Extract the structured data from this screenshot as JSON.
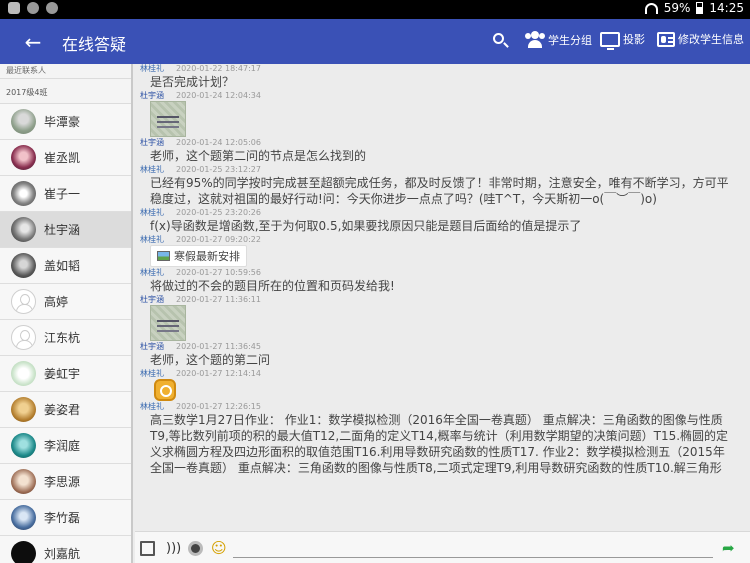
{
  "status_bar": {
    "battery": "59%",
    "time": "14:25"
  },
  "app_bar": {
    "title": "在线答疑",
    "actions": {
      "groups": "学生分组",
      "projection": "投影",
      "edit_info": "修改学生信息"
    }
  },
  "sidebar": {
    "header": "最近联系人",
    "section": "2017级4班",
    "contacts": [
      {
        "name": "毕潭豪"
      },
      {
        "name": "崔丞凯"
      },
      {
        "name": "崔子一"
      },
      {
        "name": "杜宇涵"
      },
      {
        "name": "盖如韬"
      },
      {
        "name": "高婷"
      },
      {
        "name": "江东杭"
      },
      {
        "name": "姜虹宇"
      },
      {
        "name": "姜姿君"
      },
      {
        "name": "李润庭"
      },
      {
        "name": "李思源"
      },
      {
        "name": "李竹磊"
      },
      {
        "name": "刘嘉航"
      }
    ]
  },
  "chat": {
    "messages": [
      {
        "sender": "林桂礼",
        "time": "2020-01-22 18:47:17",
        "text": "是否完成计划？"
      },
      {
        "sender": "杜宇涵",
        "time": "2020-01-24 12:04:34"
      },
      {
        "sender": "杜宇涵",
        "time": "2020-01-24 12:05:06",
        "text": "老师，这个题第二问的节点是怎么找到的"
      },
      {
        "sender": "林桂礼",
        "time": "2020-01-25 23:12:27",
        "text": "已经有95%的同学按时完成甚至超额完成任务，都及时反馈了！非常时期，注意安全，唯有不断学习，方可平稳度过，这就对祖国的最好行动!问：今天你进步一点点了吗？(哇T^T，今天斯初一o(￣︶￣)o)"
      },
      {
        "sender": "林桂礼",
        "time": "2020-01-25 23:20:26",
        "text": "f(x)导函数是增函数,至于为何取0.5,如果要找原因只能是题目后面给的值是提示了"
      },
      {
        "sender": "林桂礼",
        "time": "2020-01-27 09:20:22",
        "attachment": "寒假最新安排"
      },
      {
        "sender": "林桂礼",
        "time": "2020-01-27 10:59:56",
        "text": "将做过的不会的题目所在的位置和页码发给我!"
      },
      {
        "sender": "杜宇涵",
        "time": "2020-01-27 11:36:11"
      },
      {
        "sender": "杜宇涵",
        "time": "2020-01-27 11:36:45",
        "text": "老师，这个题的第二问"
      },
      {
        "sender": "林桂礼",
        "time": "2020-01-27 12:14:14"
      },
      {
        "sender": "林桂礼",
        "time": "2020-01-27 12:26:15",
        "text": "高三数学1月27日作业：  作业1：数学模拟检测（2016年全国一卷真题）  重点解决：三角函数的图像与性质T9,等比数列前项的积的最大值T12,二面角的定义T14,概率与统计（利用数学期望的决策问题）T15.椭圆的定义求椭圆方程及四边形面积的取值范围T16.利用导数研究函数的性质T17.  作业2：数学模拟检测五（2015年全国一卷真题）  重点解决：三角函数的图像与性质T8,二项式定理T9,利用导数研究函数的性质T10.解三角形"
      }
    ]
  },
  "input": {
    "placeholder": ""
  }
}
